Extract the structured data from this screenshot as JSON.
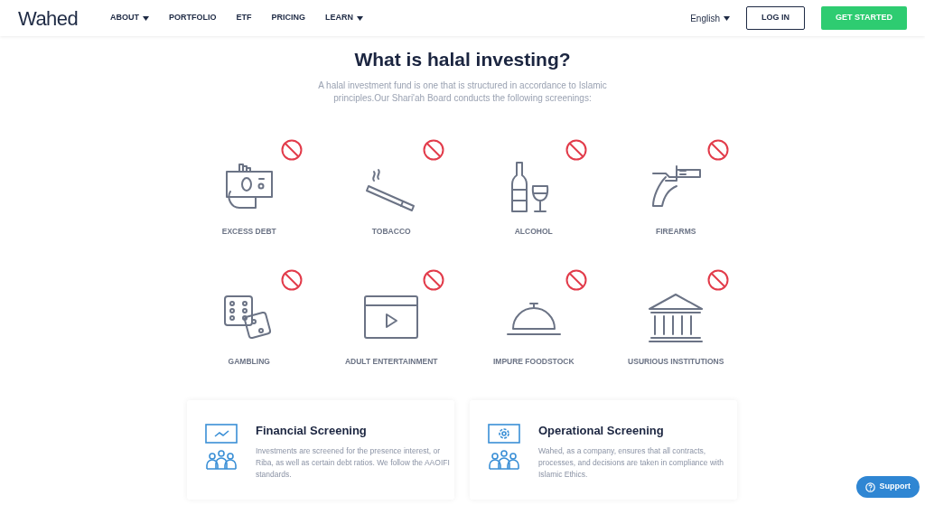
{
  "header": {
    "logo": "Wahed",
    "nav": [
      {
        "label": "ABOUT",
        "dropdown": true
      },
      {
        "label": "PORTFOLIO",
        "dropdown": false
      },
      {
        "label": "ETF",
        "dropdown": false
      },
      {
        "label": "PRICING",
        "dropdown": false
      },
      {
        "label": "LEARN",
        "dropdown": true
      }
    ],
    "language": "English",
    "login": "LOG IN",
    "cta": "GET STARTED"
  },
  "title": "What is halal investing?",
  "intro": "A halal investment fund is one that is structured in accordance to Islamic principles.Our Shari'ah Board conducts the following screenings:",
  "screenings": [
    {
      "kind": "debt",
      "label": "EXCESS DEBT"
    },
    {
      "kind": "tobacco",
      "label": "TOBACCO"
    },
    {
      "kind": "alcohol",
      "label": "ALCOHOL"
    },
    {
      "kind": "firearms",
      "label": "FIREARMS"
    },
    {
      "kind": "gambling",
      "label": "GAMBLING"
    },
    {
      "kind": "adult",
      "label": "ADULT ENTERTAINMENT"
    },
    {
      "kind": "food",
      "label": "IMPURE FOODSTOCK"
    },
    {
      "kind": "institution",
      "label": "USURIOUS INSTITUTIONS"
    }
  ],
  "cards": [
    {
      "kind": "financial",
      "title": "Financial Screening",
      "text": "Investments are screened for the presence interest, or Riba, as well as certain debt ratios. We follow the AAOIFI standards."
    },
    {
      "kind": "operational",
      "title": "Operational Screening",
      "text": "Wahed, as a company, ensures that all contracts, processes, and decisions are taken in compliance with Islamic Ethics."
    }
  ],
  "support": "Support"
}
